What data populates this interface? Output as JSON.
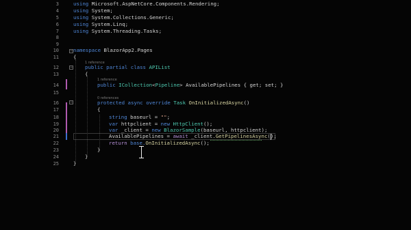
{
  "line_numbers": [
    "3",
    "4",
    "5",
    "6",
    "7",
    "8",
    "9",
    "10",
    "11",
    "12",
    "13",
    "14",
    "15",
    "16",
    "17",
    "18",
    "19",
    "20",
    "21",
    "22",
    "23",
    "24",
    "25"
  ],
  "lines": {
    "l3": {
      "a": "using ",
      "b": "Microsoft.AspNetCore.Components.Rendering;"
    },
    "l4": {
      "a": "using ",
      "b": "System;"
    },
    "l5": {
      "a": "using ",
      "b": "System.Collections.Generic;"
    },
    "l6": {
      "a": "using ",
      "b": "System.Linq;"
    },
    "l7": {
      "a": "using ",
      "b": "System.Threading.Tasks;"
    },
    "l10": {
      "a": "namespace ",
      "b": "BlazorApp2.Pages"
    },
    "l11": {
      "a": "{"
    },
    "l12": {
      "a": "public partial class ",
      "b": "APIList"
    },
    "l13": {
      "a": "{"
    },
    "l14": {
      "a": "public ",
      "b": "ICollection",
      "c": "<",
      "d": "Pipeline",
      "e": "> ",
      "f": "AvailablePipelines",
      "g": " { get; set; }"
    },
    "l16": {
      "a": "protected async override ",
      "b": "Task ",
      "c": "OnInitializedAsync",
      "d": "()"
    },
    "l17": {
      "a": "{"
    },
    "l18": {
      "a": "string ",
      "b": "baseurl = ",
      "c": "\"\"",
      "d": ";"
    },
    "l19": {
      "a": "var ",
      "b": "httpclient = ",
      "c": "new ",
      "d": "HttpClient",
      "e": "();"
    },
    "l20": {
      "a": "var ",
      "b": "_client = ",
      "c": "new ",
      "d": "BlazorSample",
      "e": "(baseurl, httpclient);"
    },
    "l21": {
      "a": "AvailablePipelines = ",
      "b": "await ",
      "c": "_client.",
      "d": "GetPipelinesAsync",
      "e": "();"
    },
    "l22": {
      "a": "return ",
      "b": "base.",
      "c": "OnInitializedAsync",
      "d": "();"
    },
    "l23": {
      "a": "}"
    },
    "l24": {
      "a": "}"
    },
    "l25": {
      "a": "}"
    }
  },
  "references": {
    "r12": "1 reference",
    "r14": "1 reference",
    "r16": "0 references"
  },
  "colors": {
    "background": "#050505",
    "keyword": "#4f86d6",
    "type": "#4ec9b0",
    "method": "#d8d4a2",
    "string": "#d69d85",
    "change_bar": "#b05ab0"
  }
}
